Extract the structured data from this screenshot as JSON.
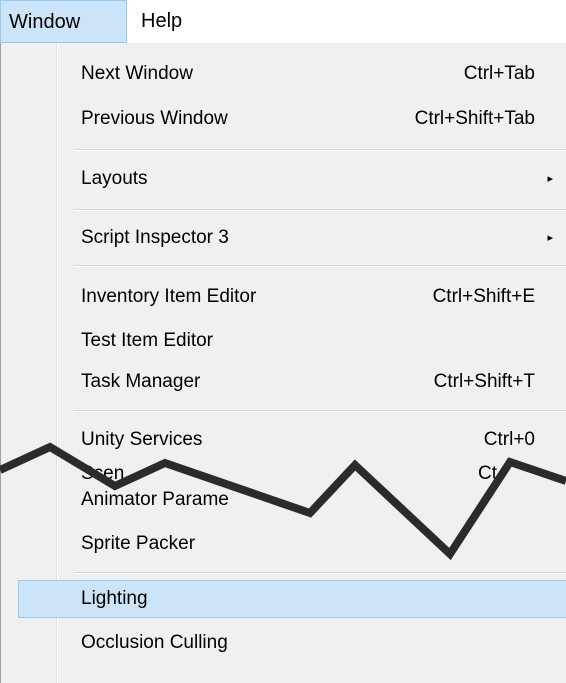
{
  "menubar": {
    "window_label": "Window",
    "help_label": "Help"
  },
  "menu": {
    "items": [
      {
        "label": "Next Window",
        "shortcut": "Ctrl+Tab"
      },
      {
        "label": "Previous Window",
        "shortcut": "Ctrl+Shift+Tab"
      },
      {
        "label": "Layouts",
        "submenu": "▸"
      },
      {
        "label": "Script Inspector 3",
        "submenu": "▸"
      },
      {
        "label": "Inventory Item Editor",
        "shortcut": "Ctrl+Shift+E"
      },
      {
        "label": "Test Item Editor",
        "shortcut": ""
      },
      {
        "label": "Task Manager",
        "shortcut": "Ctrl+Shift+T"
      },
      {
        "label": "Unity Services",
        "shortcut": "Ctrl+0"
      },
      {
        "label": "Scen",
        "shortcut": "Ct"
      },
      {
        "label": "Animator Parame",
        "shortcut": ""
      },
      {
        "label": "Sprite Packer",
        "shortcut": ""
      },
      {
        "label": "Lighting",
        "shortcut": ""
      },
      {
        "label": "Occlusion Culling",
        "shortcut": ""
      }
    ]
  },
  "colors": {
    "highlight_bg": "#cce4f7",
    "highlight_border": "#99c9ef",
    "menu_bg": "#f0f0f0"
  }
}
